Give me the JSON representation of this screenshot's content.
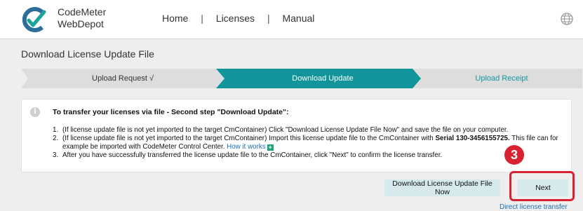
{
  "header": {
    "brand_line1": "CodeMeter",
    "brand_line2": "WebDepot",
    "nav": [
      "Home",
      "Licenses",
      "Manual"
    ],
    "nav_separator": "|"
  },
  "page": {
    "title": "Download License Update File"
  },
  "steps": [
    {
      "label": "Upload Request √",
      "state": "done"
    },
    {
      "label": "Download Update",
      "state": "active"
    },
    {
      "label": "Upload Receipt",
      "state": "pending"
    }
  ],
  "info": {
    "heading": "To transfer your licenses via file - Second step \"Download Update\":",
    "item1_num": "1.",
    "item1": "(If license update file is not yet imported to the target CmContainer) Click \"Download License Update File Now\" and save the file on your computer.",
    "item2_num": "2.",
    "item2_a": "(If license update file is not yet imported to the target CmContainer) Import this license update file to the CmContainer with ",
    "item2_serial": "Serial 130-3456155725.",
    "item2_b": " This file can for example be imported with CodeMeter Control Center. ",
    "item2_link": "How it works",
    "item3_num": "3.",
    "item3": "After you have successfully transferred the license update file to the CmContainer, click \"Next\" to confirm the license transfer."
  },
  "buttons": {
    "download": "Download License Update File Now",
    "next": "Next"
  },
  "callout_number": "3",
  "direct_link": "Direct license transfer",
  "colors": {
    "teal": "#12959a",
    "step_inactive": "#dddddd",
    "button_bg": "#d6e9ec",
    "highlight_red": "#d82231",
    "link_blue": "#1f6fb2"
  },
  "icons": {
    "logo": "codemeter-logo-icon",
    "globe": "globe-icon",
    "info": "info-icon",
    "plus": "plus-icon"
  }
}
